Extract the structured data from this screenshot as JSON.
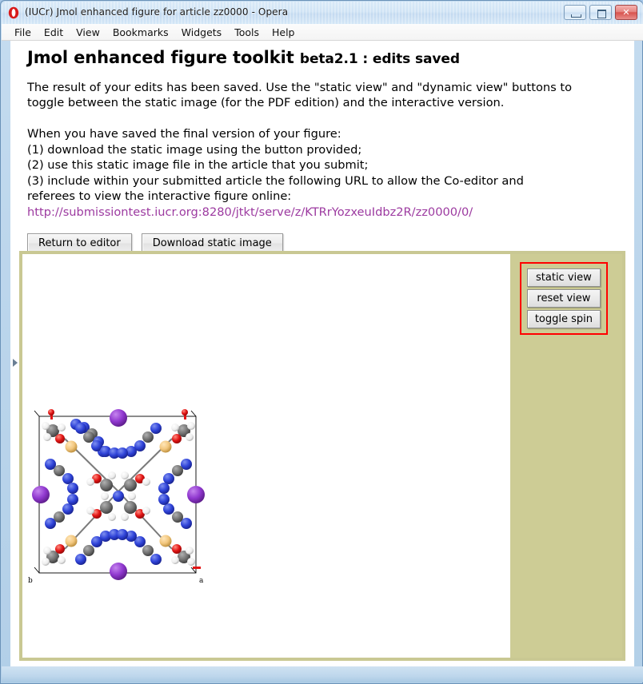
{
  "window": {
    "title": "(IUCr) Jmol enhanced figure for article zz0000 - Opera",
    "app_icon": "opera-logo-icon",
    "controls": {
      "minimize": "minimize-icon",
      "maximize": "maximize-icon",
      "close": "✕"
    }
  },
  "menubar": {
    "items": [
      {
        "label": "File"
      },
      {
        "label": "Edit"
      },
      {
        "label": "View"
      },
      {
        "label": "Bookmarks"
      },
      {
        "label": "Widgets"
      },
      {
        "label": "Tools"
      },
      {
        "label": "Help"
      }
    ]
  },
  "page": {
    "heading_main": "Jmol enhanced figure toolkit",
    "heading_sub": "beta2.1 : edits saved",
    "intro": "The result of your edits has been saved. Use the \"static view\" and \"dynamic view\" buttons to toggle between the static image (for the PDF edition) and the interactive version.",
    "instructions_lead": "When you have saved the final version of your figure:",
    "instructions": [
      "(1) download the static image using the button provided;",
      "(2) use this static image file in the article that you submit;",
      "(3) include within your submitted article the following URL to allow the Co-editor and",
      "referees to view the interactive figure online:"
    ],
    "url": "http://submissiontest.iucr.org:8280/jtkt/serve/z/KTRrYozxeuIdbz2R/zz0000/0/",
    "url_color": "#9c3aa0",
    "buttons": {
      "return": "Return to editor",
      "download": "Download static image"
    }
  },
  "figure": {
    "panel_bg": "#cdcc95",
    "border_color": "#c9c893",
    "controls_border": "#ff0000",
    "controls": [
      {
        "label": "static view"
      },
      {
        "label": "reset view"
      },
      {
        "label": "toggle spin"
      }
    ],
    "axis_labels": {
      "left": "b",
      "right": "a"
    },
    "atom_colors": {
      "carbon": "#606060",
      "nitrogen": "#2a3fd0",
      "oxygen": "#e01010",
      "hydrogen": "#f2f2f2",
      "potassium": "#8f3fcf",
      "sulfur": "#f0c884"
    }
  }
}
